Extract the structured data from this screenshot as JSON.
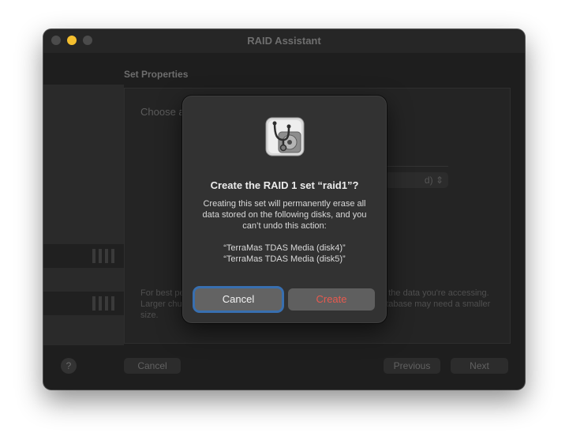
{
  "window": {
    "title": "RAID Assistant"
  },
  "page": {
    "header": "Set Properties",
    "intro": "Choose a chunk (stripe) size, for the RAID 1 volume.",
    "hint": "For best performance, choose a chunk size similar to the size of the data you're accessing. Larger chunk sizes work well with large chunks of data, but a database may need a smaller size.",
    "popup_value": "d)"
  },
  "footer": {
    "help_label": "?",
    "cancel_label": "Cancel",
    "previous_label": "Previous",
    "next_label": "Next"
  },
  "alert": {
    "icon": "disk-utility-icon",
    "title": "Create the RAID 1 set “raid1”?",
    "message": "Creating this set will permanently erase all data stored on the following disks, and you can’t undo this action:",
    "disks": [
      "“TerraMas TDAS Media (disk4)”",
      "“TerraMas TDAS Media (disk5)”"
    ],
    "cancel_label": "Cancel",
    "create_label": "Create"
  },
  "colors": {
    "accent_focus": "#3a7ac7",
    "destructive": "#e85a4f",
    "minimize": "#f5bf2f"
  }
}
